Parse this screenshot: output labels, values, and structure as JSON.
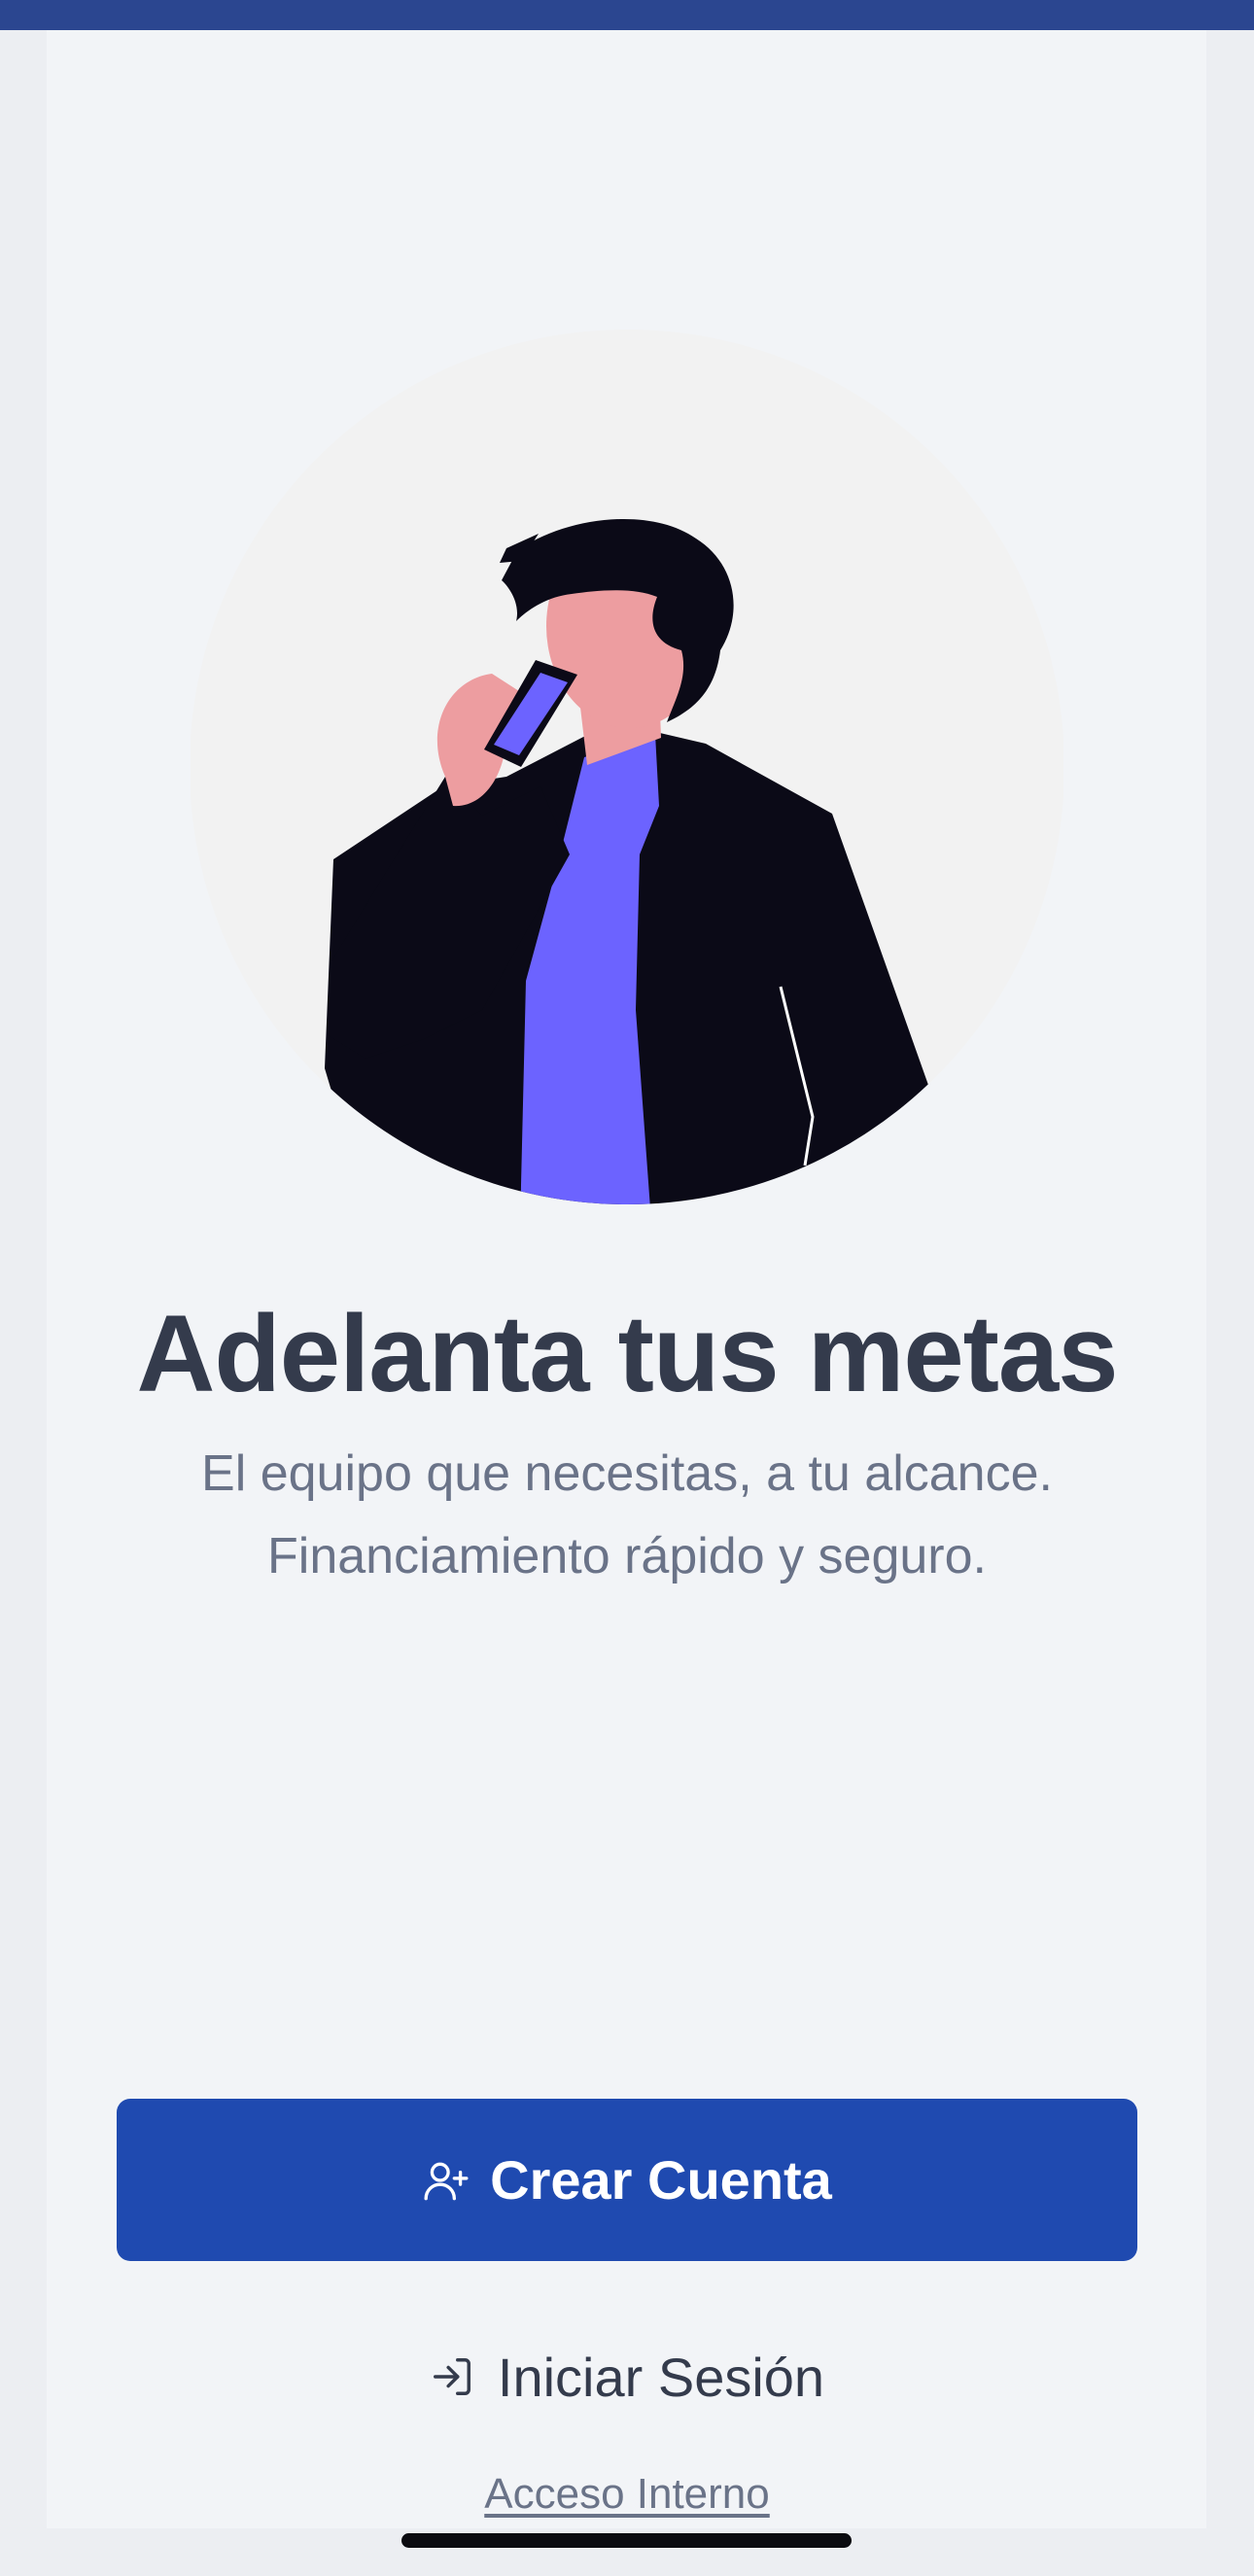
{
  "brand": {
    "top_bar_color": "#2b4690",
    "primary_color": "#1f4ab0",
    "accent_color": "#6c63ff"
  },
  "hero": {
    "illustration": "person-on-phone-illustration",
    "title": "Adelanta tus metas",
    "subtitle": "El equipo que necesitas, a tu alcance. Financiamiento rápido y seguro."
  },
  "actions": {
    "create_account": {
      "label": "Crear Cuenta",
      "icon": "user-plus-icon"
    },
    "sign_in": {
      "label": "Iniciar Sesión",
      "icon": "log-in-icon"
    },
    "internal_access": {
      "label": "Acceso Interno"
    }
  }
}
